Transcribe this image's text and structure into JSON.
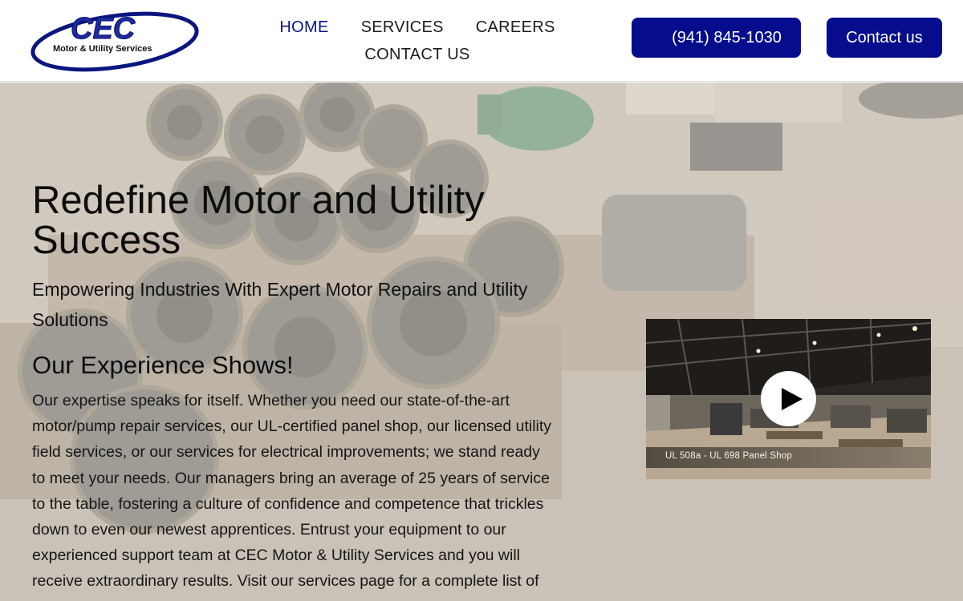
{
  "brand": {
    "logo_letters": "CEC",
    "logo_tagline": "Motor & Utility Services",
    "primary_color": "#060d8c",
    "logo_swoosh_color": "#0a1580"
  },
  "nav": {
    "items": [
      {
        "label": "HOME",
        "active": true
      },
      {
        "label": "SERVICES",
        "active": false
      },
      {
        "label": "CAREERS",
        "active": false
      },
      {
        "label": "CONTACT US",
        "active": false
      }
    ]
  },
  "header": {
    "phone_label": "(941) 845-1030",
    "contact_label": "Contact us"
  },
  "hero": {
    "title": "Redefine Motor and Utility Success",
    "subtitle": "Empowering Industries With Expert Motor Repairs and Utility Solutions",
    "section_heading": "Our Experience Shows!",
    "body": "Our expertise speaks for itself. Whether you need our state-of-the-art motor/pump repair services, our UL-certified panel shop, our licensed utility field services, or our services for electrical improvements; we stand ready to meet your needs. Our managers bring an average of 25 years of service to the table, fostering a culture of confidence and competence that trickles down to even our newest apprentices.  Entrust your equipment to our experienced support team at CEC Motor & Utility Services and you will receive extraordinary results. Visit our services page for a complete list of services."
  },
  "video": {
    "caption": "UL 508a - UL 698 Panel Shop",
    "play_icon": "play-icon"
  }
}
